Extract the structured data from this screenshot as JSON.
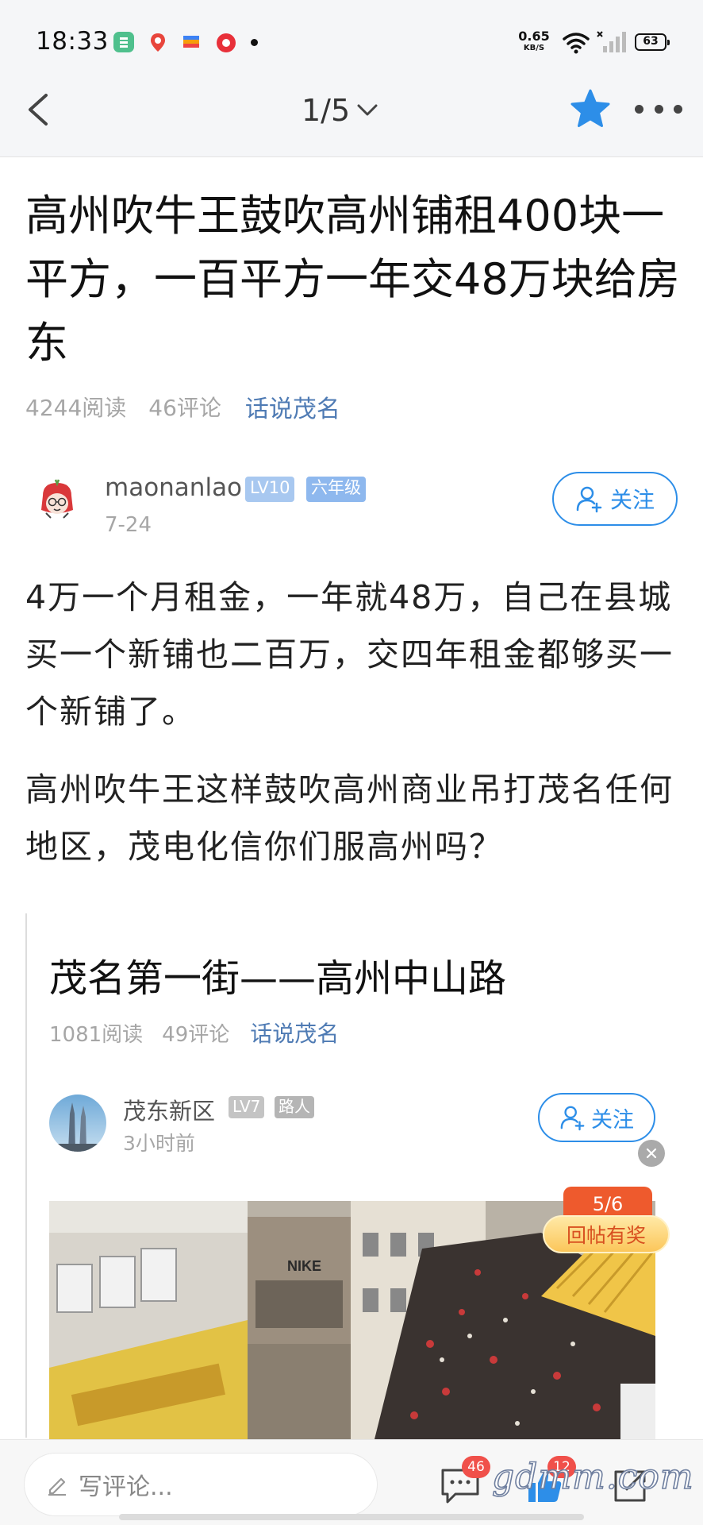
{
  "status_bar": {
    "time": "18:33",
    "net_speed_value": "0.65",
    "net_speed_unit": "KB/S",
    "battery": "63",
    "icons": [
      "app-green-icon",
      "map-pin-icon",
      "colorful-app-icon",
      "red-record-icon",
      "wifi-icon",
      "signal-icon",
      "battery-icon"
    ]
  },
  "nav": {
    "pager": "1/5",
    "icons": [
      "chevron-left-icon",
      "chevron-down-icon",
      "star-icon",
      "more-icon"
    ]
  },
  "article": {
    "title": "高州吹牛王鼓吹高州铺租400块一平方，一百平方一年交48万块给房东",
    "reads": "4244阅读",
    "comments": "46评论",
    "forum": "话说茂名",
    "author": {
      "name": "maonanlao",
      "level": "LV10",
      "grade": "六年级",
      "date": "7-24",
      "follow_label": "关注"
    },
    "paragraphs": [
      "4万一个月租金，一年就48万，自己在县城买一个新铺也二百万，交四年租金都够买一个新铺了。",
      "高州吹牛王这样鼓吹高州商业吊打茂名任何地区，茂电化信你们服高州吗？"
    ]
  },
  "quoted_post": {
    "title": "茂名第一街——高州中山路",
    "reads": "1081阅读",
    "comments": "49评论",
    "forum": "话说茂名",
    "author": {
      "name": "茂东新区",
      "level": "LV7",
      "grade": "路人",
      "time": "3小时前",
      "follow_label": "关注"
    },
    "image_sign_text": "NIKE"
  },
  "reward": {
    "progress": "5/6",
    "label": "回帖有奖"
  },
  "bottom_bar": {
    "comment_placeholder": "写评论...",
    "comment_count": "46",
    "like_count": "12"
  },
  "watermark": "gdmm.com",
  "colors": {
    "accent_blue": "#2d8ee8",
    "forum_link": "#4f7bb4",
    "reward_orange": "#ee5a2d",
    "badge_red": "#f0504a"
  }
}
